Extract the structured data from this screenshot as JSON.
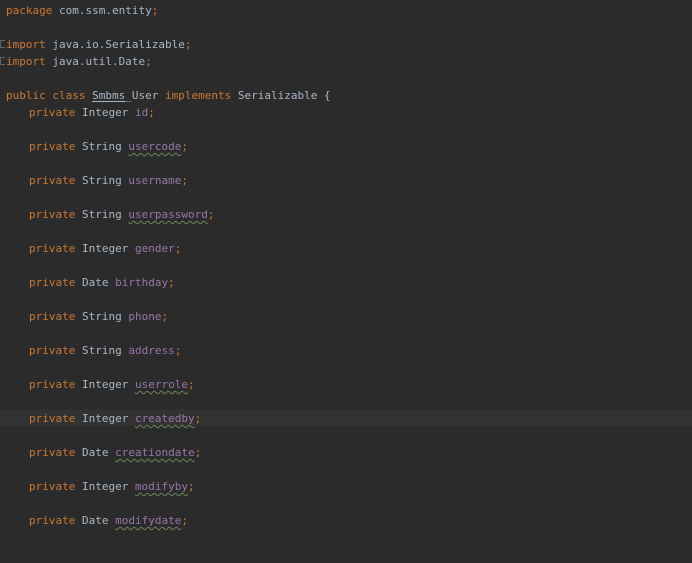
{
  "editor": {
    "package_line": {
      "keyword": "package",
      "name": "com.ssm.entity",
      "semicolon": ";"
    },
    "imports": [
      {
        "keyword": "import",
        "name": "java.io.Serializable",
        "semicolon": ";"
      },
      {
        "keyword": "import",
        "name": "java.util.Date",
        "semicolon": ";"
      }
    ],
    "class_decl": {
      "modifier": "public",
      "keyword": "class",
      "name_typo": "Smbms",
      "name_rest": "_User",
      "implements": "implements",
      "interface": "Serializable",
      "brace": "{"
    },
    "fields": [
      {
        "modifier": "private",
        "type": "Integer",
        "name": "id",
        "semicolon": ";"
      },
      {
        "modifier": "private",
        "type": "String",
        "name": "usercode",
        "semicolon": ";"
      },
      {
        "modifier": "private",
        "type": "String",
        "name": "username",
        "semicolon": ";"
      },
      {
        "modifier": "private",
        "type": "String",
        "name": "userpassword",
        "semicolon": ";"
      },
      {
        "modifier": "private",
        "type": "Integer",
        "name": "gender",
        "semicolon": ";"
      },
      {
        "modifier": "private",
        "type": "Date",
        "name": "birthday",
        "semicolon": ";"
      },
      {
        "modifier": "private",
        "type": "String",
        "name": "phone",
        "semicolon": ";"
      },
      {
        "modifier": "private",
        "type": "String",
        "name": "address",
        "semicolon": ";"
      },
      {
        "modifier": "private",
        "type": "Integer",
        "name": "userrole",
        "semicolon": ";"
      },
      {
        "modifier": "private",
        "type": "Integer",
        "name": "createdby",
        "semicolon": ";"
      },
      {
        "modifier": "private",
        "type": "Date",
        "name": "creationdate",
        "semicolon": ";"
      },
      {
        "modifier": "private",
        "type": "Integer",
        "name": "modifyby",
        "semicolon": ";"
      },
      {
        "modifier": "private",
        "type": "Date",
        "name": "modifydate",
        "semicolon": ";"
      }
    ]
  },
  "colors": {
    "background": "#2b2b2b",
    "current_line": "#323232",
    "keyword": "#cc7832",
    "field": "#9876aa",
    "plain": "#a9b7c6"
  }
}
